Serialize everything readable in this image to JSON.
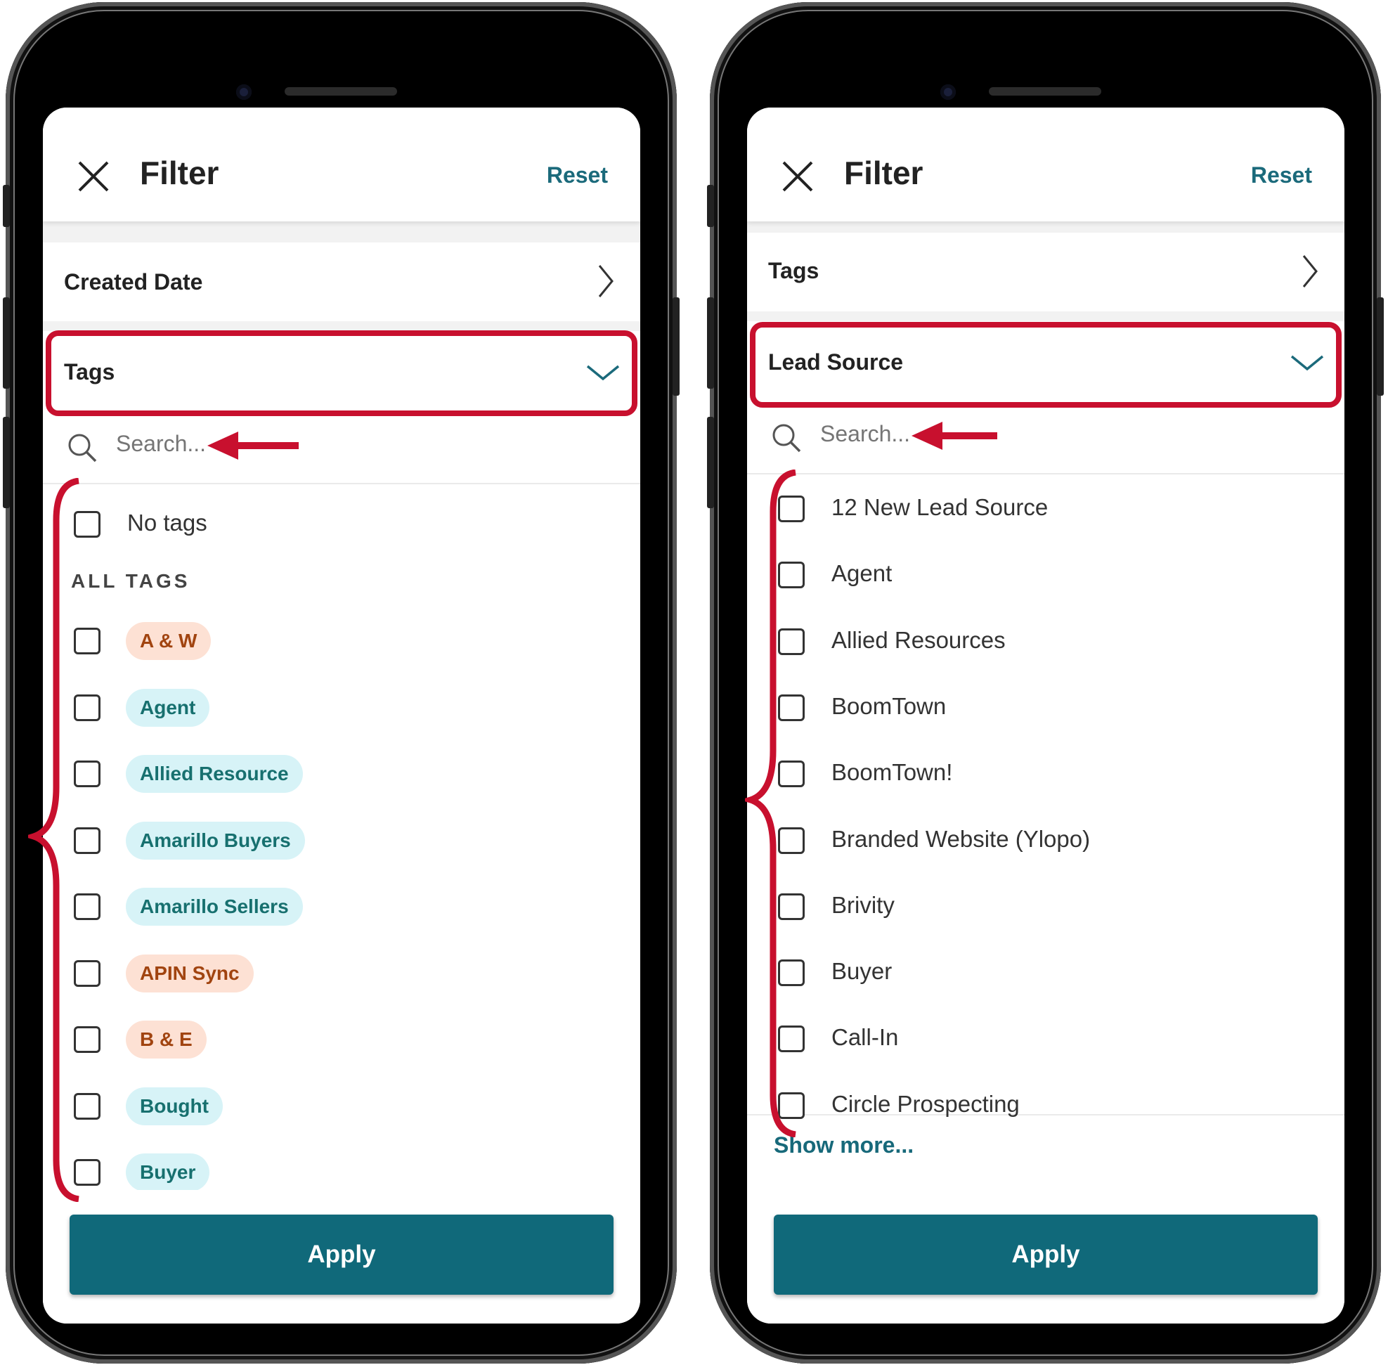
{
  "colors": {
    "accent": "#10697a",
    "annotation": "#c8102e",
    "tag_orange_bg": "#fde1d4",
    "tag_teal_bg": "#d7f3f7"
  },
  "left": {
    "header": {
      "title": "Filter",
      "reset_label": "Reset"
    },
    "section_collapsed": {
      "label": "Created Date"
    },
    "section_expanded": {
      "label": "Tags"
    },
    "search": {
      "placeholder": "Search..."
    },
    "no_tags_label": "No tags",
    "group_header": "ALL TAGS",
    "tags": [
      {
        "label": "A & W",
        "color": "orange"
      },
      {
        "label": "Agent",
        "color": "teal"
      },
      {
        "label": "Allied Resource",
        "color": "teal"
      },
      {
        "label": "Amarillo Buyers",
        "color": "teal"
      },
      {
        "label": "Amarillo Sellers",
        "color": "teal"
      },
      {
        "label": "APIN Sync",
        "color": "orange"
      },
      {
        "label": "B & E",
        "color": "orange"
      },
      {
        "label": "Bought",
        "color": "teal"
      },
      {
        "label": "Buyer",
        "color": "teal"
      }
    ],
    "apply_label": "Apply"
  },
  "right": {
    "header": {
      "title": "Filter",
      "reset_label": "Reset"
    },
    "section_collapsed": {
      "label": "Tags"
    },
    "section_expanded": {
      "label": "Lead Source"
    },
    "search": {
      "placeholder": "Search..."
    },
    "sources": [
      "12 New Lead Source",
      "Agent",
      "Allied Resources",
      "BoomTown",
      "BoomTown!",
      "Branded Website (Ylopo)",
      "Brivity",
      "Buyer",
      "Call-In",
      "Circle Prospecting"
    ],
    "show_more_label": "Show more...",
    "apply_label": "Apply"
  }
}
